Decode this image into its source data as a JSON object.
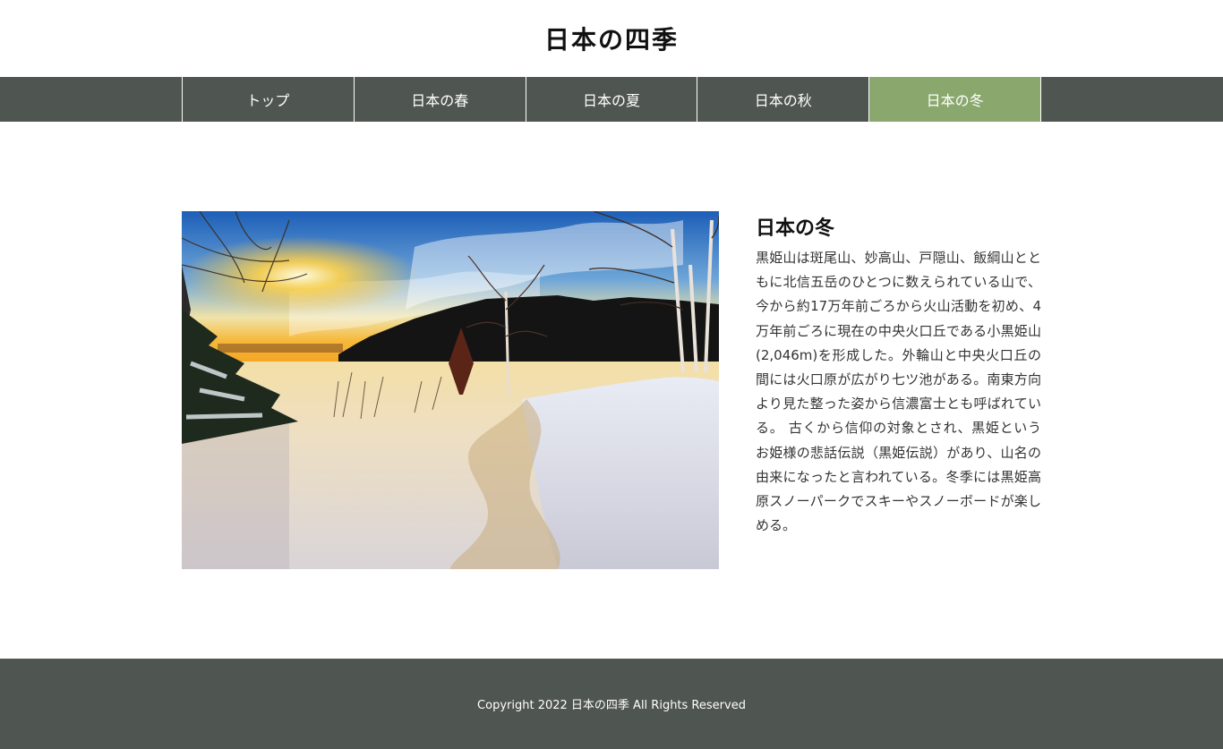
{
  "header": {
    "title": "日本の四季"
  },
  "nav": {
    "items": [
      {
        "label": "トップ",
        "active": false
      },
      {
        "label": "日本の春",
        "active": false
      },
      {
        "label": "日本の夏",
        "active": false
      },
      {
        "label": "日本の秋",
        "active": false
      },
      {
        "label": "日本の冬",
        "active": true
      }
    ]
  },
  "main": {
    "heading": "日本の冬",
    "body": "黒姫山は斑尾山、妙高山、戸隠山、飯綱山とともに北信五岳のひとつに数えられている山で、今から約17万年前ごろから火山活動を初め、4万年前ごろに現在の中央火口丘である小黒姫山(2,046m)を形成した。外輪山と中央火口丘の間には火口原が広がり七ツ池がある。南東方向より見た整った姿から信濃富士とも呼ばれている。 古くから信仰の対象とされ、黒姫というお姫様の悲話伝説（黒姫伝説）があり、山名の由来になったと言われている。冬季には黒姫高原スノーパークでスキーやスノーボードが楽しめる。"
  },
  "footer": {
    "copyright": "Copyright 2022 日本の四季 All Rights Reserved"
  },
  "colors": {
    "nav_bg": "#4f5550",
    "nav_active": "#8aa86e",
    "footer_bg": "#4f5550"
  }
}
